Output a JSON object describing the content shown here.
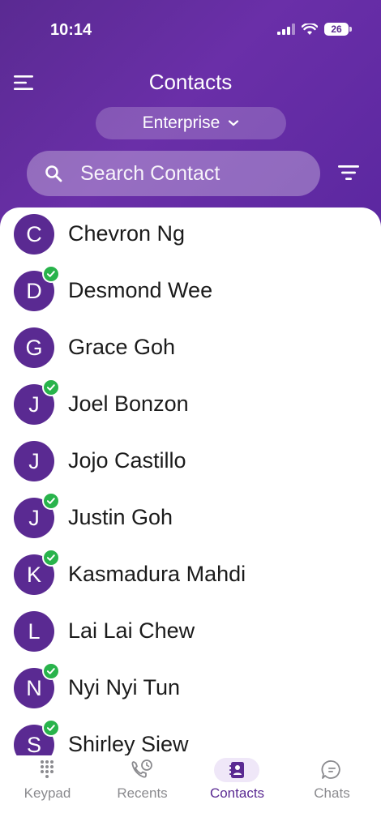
{
  "status_bar": {
    "time": "10:14",
    "battery": "26"
  },
  "header": {
    "title": "Contacts",
    "menu_icon": "hamburger-menu-icon",
    "filter_icon": "filter-icon"
  },
  "selector": {
    "value": "Enterprise",
    "icon": "chevron-down-icon"
  },
  "search": {
    "placeholder": "Search Contact",
    "icon": "search-icon"
  },
  "contacts": [
    {
      "initial": "C",
      "name": "Chevron Ng",
      "online": false
    },
    {
      "initial": "D",
      "name": "Desmond Wee",
      "online": true
    },
    {
      "initial": "G",
      "name": "Grace Goh",
      "online": false
    },
    {
      "initial": "J",
      "name": "Joel Bonzon",
      "online": true
    },
    {
      "initial": "J",
      "name": "Jojo Castillo",
      "online": false
    },
    {
      "initial": "J",
      "name": "Justin Goh",
      "online": true
    },
    {
      "initial": "K",
      "name": "Kasmadura Mahdi",
      "online": true
    },
    {
      "initial": "L",
      "name": "Lai Lai Chew",
      "online": false
    },
    {
      "initial": "N",
      "name": "Nyi Nyi Tun",
      "online": true
    },
    {
      "initial": "S",
      "name": "Shirley Siew",
      "online": true
    }
  ],
  "tabs": [
    {
      "label": "Keypad",
      "icon": "keypad-icon",
      "active": false
    },
    {
      "label": "Recents",
      "icon": "recents-icon",
      "active": false
    },
    {
      "label": "Contacts",
      "icon": "contacts-icon",
      "active": true
    },
    {
      "label": "Chats",
      "icon": "chats-icon",
      "active": false
    }
  ],
  "colors": {
    "brand_purple": "#5a2a92",
    "online_green": "#28b34b",
    "inactive_gray": "#8b8b8f"
  }
}
